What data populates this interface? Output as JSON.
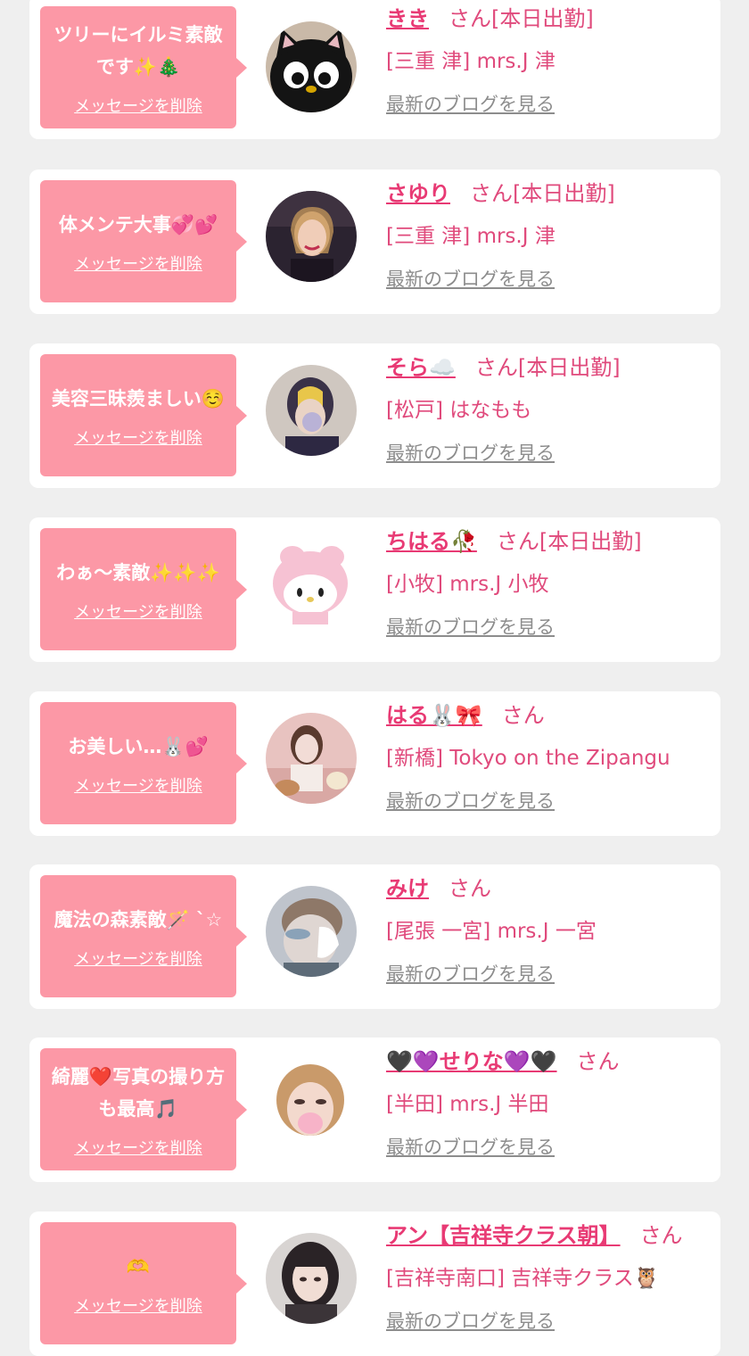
{
  "cards": [
    {
      "message": "ツリーにイルミ素敵です✨🎄",
      "delete_label": "メッセージを削除",
      "name": "きき",
      "suffix": "さん[本日出勤]",
      "shop": "[三重 津] mrs.J 津",
      "blog_label": "最新のブログを見る",
      "avatar_icon": "black-cat-icon"
    },
    {
      "message": "体メンテ大事💞💕",
      "delete_label": "メッセージを削除",
      "name": "さゆり",
      "suffix": "さん[本日出勤]",
      "shop": "[三重 津] mrs.J 津",
      "blog_label": "最新のブログを見る",
      "avatar_icon": "user-photo"
    },
    {
      "message": "美容三昧羨ましい☺️",
      "delete_label": "メッセージを削除",
      "name": "そら☁️",
      "suffix": "さん[本日出勤]",
      "shop": "[松戸] はなもも",
      "blog_label": "最新のブログを見る",
      "avatar_icon": "user-photo"
    },
    {
      "message": "わぁ〜素敵✨✨✨",
      "delete_label": "メッセージを削除",
      "name": "ちはる🥀",
      "suffix": "さん[本日出勤]",
      "shop": "[小牧] mrs.J 小牧",
      "blog_label": "最新のブログを見る",
      "avatar_icon": "bunny-plush-icon"
    },
    {
      "message": "お美しい…🐰💕",
      "delete_label": "メッセージを削除",
      "name": "はる🐰🎀",
      "suffix": "さん",
      "shop": "[新橋] Tokyo on the Zipangu",
      "blog_label": "最新のブログを見る",
      "avatar_icon": "user-photo"
    },
    {
      "message": "魔法の森素敵🪄 ˋ☆",
      "delete_label": "メッセージを削除",
      "name": "みけ",
      "suffix": "さん",
      "shop": "[尾張 一宮] mrs.J 一宮",
      "blog_label": "最新のブログを見る",
      "avatar_icon": "user-photo"
    },
    {
      "message": "綺麗❤️写真の撮り方も最高🎵",
      "delete_label": "メッセージを削除",
      "name": "🖤💜せりな💜🖤",
      "suffix": "さん",
      "shop": "[半田] mrs.J 半田",
      "blog_label": "最新のブログを見る",
      "avatar_icon": "user-photo"
    },
    {
      "message": "🫶",
      "delete_label": "メッセージを削除",
      "name": "アン【吉祥寺クラス朝】",
      "suffix": "さん",
      "shop": "[吉祥寺南口] 吉祥寺クラス🦉",
      "blog_label": "最新のブログを見る",
      "avatar_icon": "user-photo"
    }
  ],
  "colors": {
    "background": "#efefef",
    "card": "#ffffff",
    "bubble": "#fc98a6",
    "name": "#e83a74",
    "shop": "#e04a7c",
    "blog_link": "#8d8d8d"
  }
}
